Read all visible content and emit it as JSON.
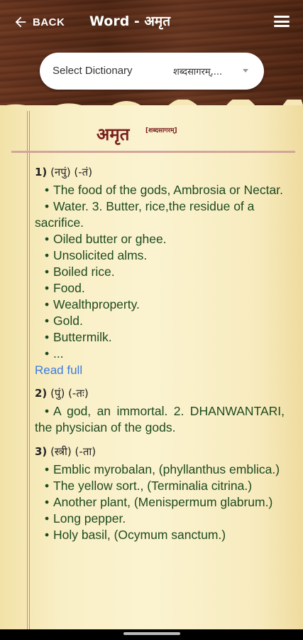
{
  "header": {
    "back_label": "BACK",
    "title": "Word - अमृत"
  },
  "dictionary_select": {
    "label": "Select Dictionary",
    "value": "शब्दसागरम्,..."
  },
  "entry": {
    "word": "अमृत",
    "source": "[शब्दसागरम्]",
    "senses": [
      {
        "num": "1)",
        "grammar": "(नपुं) (-तं)",
        "definitions": [
          "The food of the gods, Ambrosia or Nectar.",
          "Water. 3. Butter, rice,the residue of a sacrifice.",
          "Oiled butter or ghee.",
          "Unsolicited alms.",
          "Boiled rice.",
          "Food.",
          "Wealthproperty.",
          "Gold.",
          "Buttermilk.",
          "..."
        ],
        "read_full": "Read full"
      },
      {
        "num": "2)",
        "grammar": "(पुं) (-तः)",
        "definitions": [
          "A god, an immortal. 2. DHANWANTARI, the physician of the gods."
        ]
      },
      {
        "num": "3)",
        "grammar": "(स्त्री) (-ता)",
        "definitions": [
          "Emblic myrobalan, (phyllanthus emblica.)",
          "The yellow sort., (Terminalia citrina.)",
          "Another plant, (Menispermum glabrum.)",
          "Long pepper.",
          "Holy basil, (Ocymum sanctum.)"
        ]
      }
    ]
  }
}
